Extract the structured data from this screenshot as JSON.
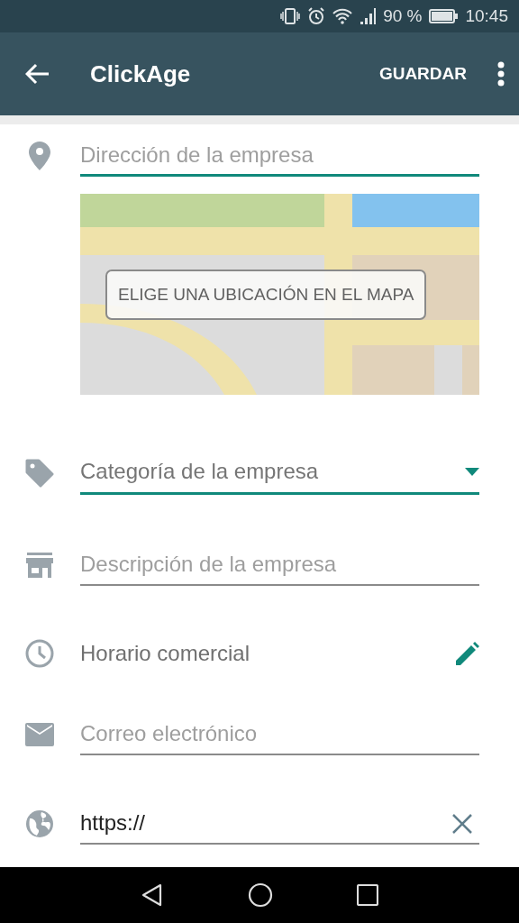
{
  "status_bar": {
    "battery": "90 %",
    "time": "10:45"
  },
  "app_bar": {
    "title": "ClickAge",
    "action": "GUARDAR"
  },
  "fields": [
    {
      "kind": "text",
      "placeholder": "Dirección de la empresa",
      "focused": true,
      "map_button": "ELIGE UNA UBICACIÓN EN EL MAPA"
    },
    {
      "kind": "select",
      "label": "Categoría de la empresa",
      "focused": true
    },
    {
      "kind": "text",
      "placeholder": "Descripción de la empresa",
      "focused": false
    },
    {
      "kind": "action",
      "label": "Horario comercial"
    },
    {
      "kind": "text",
      "placeholder": "Correo electrónico",
      "focused": false
    },
    {
      "kind": "text",
      "value": "https://",
      "focused": false
    }
  ]
}
